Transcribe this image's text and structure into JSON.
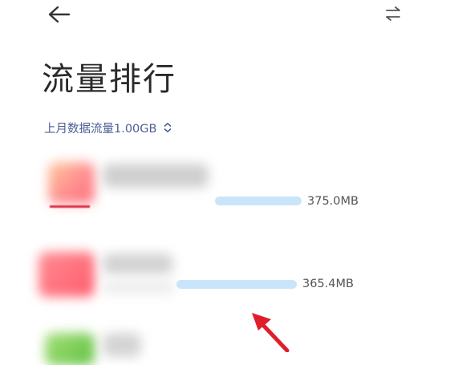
{
  "header": {
    "back_icon": "arrow-left-icon",
    "swap_icon": "swap-arrows-icon"
  },
  "page": {
    "title": "流量排行",
    "summary": "上月数据流量1.00GB",
    "summary_icon": "chevron-up-down-icon"
  },
  "apps": [
    {
      "usage": "375.0MB",
      "usage_fraction": 1.0,
      "icon_color": "#ff7e86"
    },
    {
      "usage": "365.4MB",
      "usage_fraction": 0.974,
      "icon_color": "#ff5c6c"
    },
    {
      "usage": "",
      "icon_color": "#6cc94a"
    }
  ],
  "annotation": {
    "arrow_color": "#e01e2b"
  }
}
